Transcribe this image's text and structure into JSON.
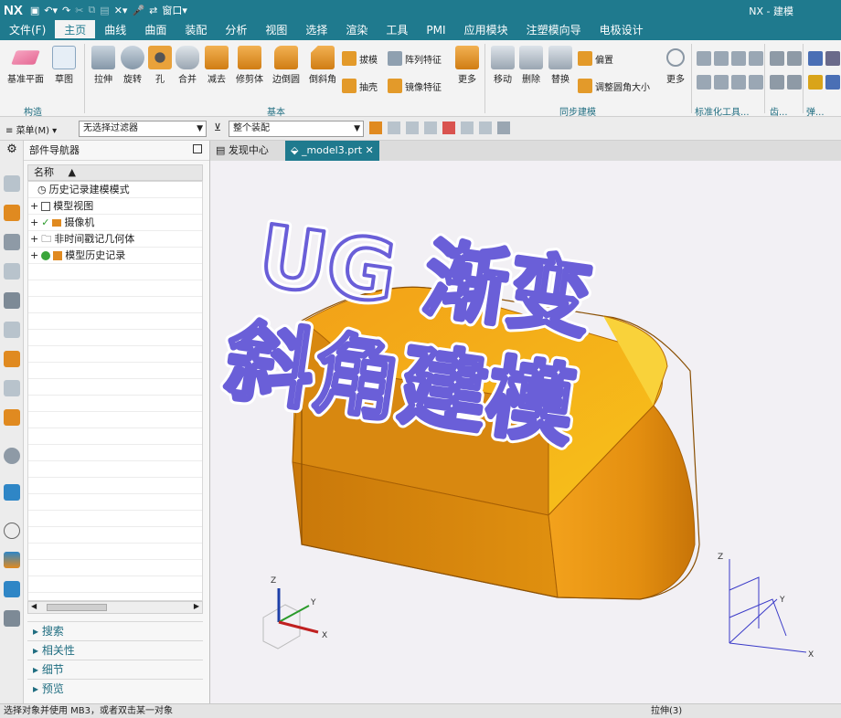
{
  "app": {
    "logo": "NX",
    "window_title": "NX - 建模",
    "window_menu": "窗口"
  },
  "menu": [
    "文件(F)",
    "主页",
    "曲线",
    "曲面",
    "装配",
    "分析",
    "视图",
    "选择",
    "渲染",
    "工具",
    "PMI",
    "应用模块",
    "注塑模向导",
    "电极设计"
  ],
  "ribbon": {
    "big_buttons": [
      "基准平面",
      "草图",
      "拉伸",
      "旋转",
      "孔",
      "合并",
      "减去",
      "修剪体",
      "边倒圆",
      "倒斜角",
      "更多",
      "移动",
      "删除",
      "替换",
      "更多"
    ],
    "small_buttons": [
      "拔模",
      "阵列特征",
      "抽壳",
      "镜像特征",
      "偏置",
      "调整圆角大小"
    ],
    "groups": [
      "构造",
      "基本",
      "同步建模",
      "标准化工具...",
      "齿...",
      "弹..."
    ]
  },
  "toolbar2": {
    "menu_label": "菜单(M)",
    "filter": "无选择过滤器",
    "scope": "整个装配"
  },
  "navigator": {
    "title": "部件导航器",
    "column": "名称",
    "items": [
      "历史记录建模模式",
      "模型视图",
      "摄像机",
      "非时间戳记几何体",
      "模型历史记录"
    ],
    "sections": [
      "搜索",
      "相关性",
      "细节",
      "预览"
    ]
  },
  "tabs": [
    "发现中心",
    "_model3.prt"
  ],
  "overlay": {
    "line1": "UG 渐变",
    "line2": "斜角建模"
  },
  "triad": {
    "x": "X",
    "y": "Y",
    "z": "Z"
  },
  "status": {
    "left": "选择对象并使用 MB3，或者双击某一对象",
    "right": "拉伸(3)"
  },
  "colors": {
    "accent": "#1f7a8e",
    "model": "#e8950f",
    "overlay_text": "#6a5fd8"
  }
}
